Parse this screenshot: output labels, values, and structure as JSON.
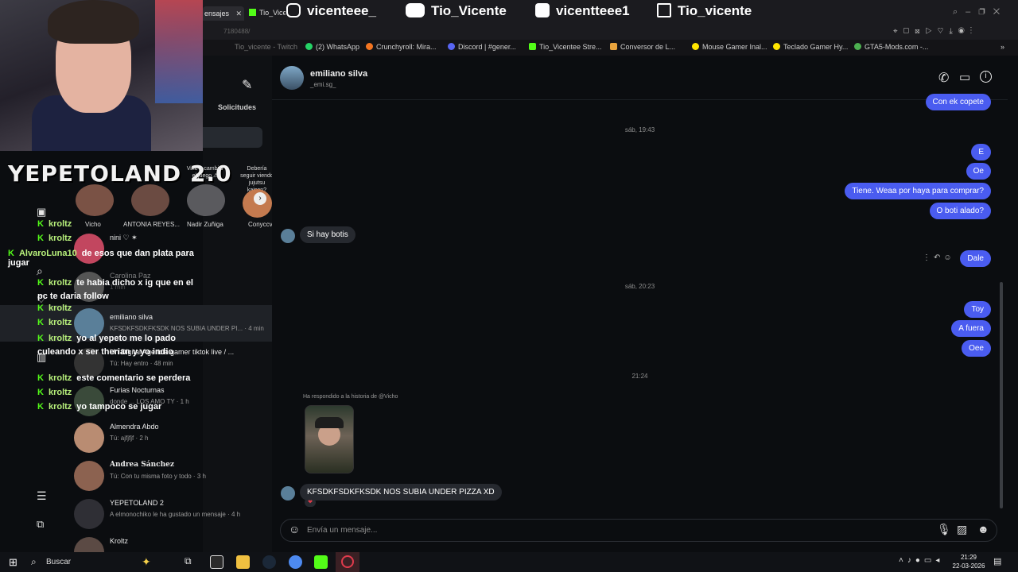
{
  "browser": {
    "tab_active": "ensajes",
    "tab_other": "Tio_Vicente Stre",
    "url_fragment": "7180488/",
    "window_controls": [
      "search-icon",
      "minimize-icon",
      "restore-icon",
      "close-icon"
    ]
  },
  "socials": [
    {
      "icon": "instagram-icon",
      "label": "vicenteee_"
    },
    {
      "icon": "youtube-icon",
      "label": "Tio_Vicente"
    },
    {
      "icon": "tiktok-icon",
      "label": "vicentteee1"
    },
    {
      "icon": "twitch-icon",
      "label": "Tio_vicente"
    }
  ],
  "bookmarks": [
    {
      "label": "Tio_vicente - Twitch",
      "color": "#9146ff"
    },
    {
      "label": "(2) WhatsApp",
      "color": "#25d366"
    },
    {
      "label": "Crunchyroll: Mira...",
      "color": "#f47521"
    },
    {
      "label": "Discord | #gener...",
      "color": "#5865f2"
    },
    {
      "label": "Tio_Vicentee Stre...",
      "color": "#53fc18"
    },
    {
      "label": "Conversor de L...",
      "color": "#e8a33d"
    },
    {
      "label": "Mouse Gamer Inal...",
      "color": "#ffe600"
    },
    {
      "label": "Teclado Gamer Hy...",
      "color": "#ffe600"
    },
    {
      "label": "GTA5-Mods.com -...",
      "color": "#4caf50"
    }
  ],
  "overlay": {
    "logo_text": "YEPETOLAND 2.0"
  },
  "sidebar": {
    "requests_label": "Solicitudes"
  },
  "stories": [
    {
      "caption": "Vine a cambiar el juego ⚠",
      "name": "Vicho"
    },
    {
      "caption": "",
      "name": "ANTONIA REYES..."
    },
    {
      "caption": "",
      "name": "Nadir Zuñiga"
    },
    {
      "caption": "Debería seguir viendo jujutsu kaisen?",
      "name": "Conyccv"
    }
  ],
  "twitch_chat": [
    {
      "user": "kroltz",
      "text": ""
    },
    {
      "user": "kroltz",
      "text": ""
    },
    {
      "user": "AlvaroLuna10",
      "text": "de esos que dan plata para jugar"
    },
    {
      "user": "kroltz",
      "text": "te habia dicho x ig que en el pc te daria follow"
    },
    {
      "user": "kroltz",
      "text": ""
    },
    {
      "user": "kroltz",
      "text": ""
    },
    {
      "user": "kroltz",
      "text": "yo al yepeto me lo pado culeando x ser therian y yo indio"
    },
    {
      "user": "kroltz",
      "text": "este comentario se perdera"
    },
    {
      "user": "kroltz",
      "text": ""
    },
    {
      "user": "kroltz",
      "text": "yo tampoco se jugar"
    }
  ],
  "conversations": [
    {
      "name": "nini ♡ ✶",
      "preview": ""
    },
    {
      "name": "Carolina Paz",
      "preview": "1 min"
    },
    {
      "name": "emiliano silva",
      "preview": "KFSDKFSDKFKSDK NOS SUBIA UNDER PI... · 4 min"
    },
    {
      "name": "Un Digital Agencia gamer tiktok live / ...",
      "preview": "Tú: Hay entro · 48 min"
    },
    {
      "name": "Furias Nocturnas",
      "preview": "donde ... LOS AMO TY · 1 h"
    },
    {
      "name": "Almendra Abdo",
      "preview": "Tú: ajfjfjf · 2 h"
    },
    {
      "name": "Andrea Sánchez",
      "preview": "Tú: Con tu misma foto y todo · 3 h"
    },
    {
      "name": "YEPETOLAND 2",
      "preview": "A elmonochiko le ha gustado un mensaje · 4 h"
    },
    {
      "name": "Kroltz",
      "preview": ""
    }
  ],
  "chat": {
    "contact_name": "emiliano silva",
    "contact_handle": "_emi.sg_",
    "messages": [
      {
        "dir": "out",
        "text": "Con ek copete"
      },
      {
        "dir": "time",
        "text": "sáb, 19:43"
      },
      {
        "dir": "out",
        "text": "E"
      },
      {
        "dir": "out",
        "text": "Oe"
      },
      {
        "dir": "out",
        "text": "Tiene. Weaa por haya para comprar?"
      },
      {
        "dir": "out",
        "text": "O boti alado?"
      },
      {
        "dir": "in",
        "text": "Si hay botis"
      },
      {
        "dir": "out",
        "text": "Dale"
      },
      {
        "dir": "time",
        "text": "sáb, 20:23"
      },
      {
        "dir": "out",
        "text": "Toy"
      },
      {
        "dir": "out",
        "text": "A fuera"
      },
      {
        "dir": "out",
        "text": "Oee"
      },
      {
        "dir": "time",
        "text": "21:24"
      },
      {
        "dir": "note",
        "text": "Ha respondido a la historia de @Vicho"
      },
      {
        "dir": "in",
        "text": "KFSDKFSDKFKSDK NOS SUBIA UNDER PIZZA XD"
      }
    ],
    "reaction": "❤",
    "composer_placeholder": "Envía un mensaje..."
  },
  "taskbar": {
    "search_label": "Buscar",
    "time": "21:29",
    "date": "22-03-2026"
  },
  "colors": {
    "outgoing_bubble": "#4a5cf0",
    "incoming_bubble": "#26292f",
    "kick_green": "#53fc18",
    "background": "#0b0d10"
  }
}
